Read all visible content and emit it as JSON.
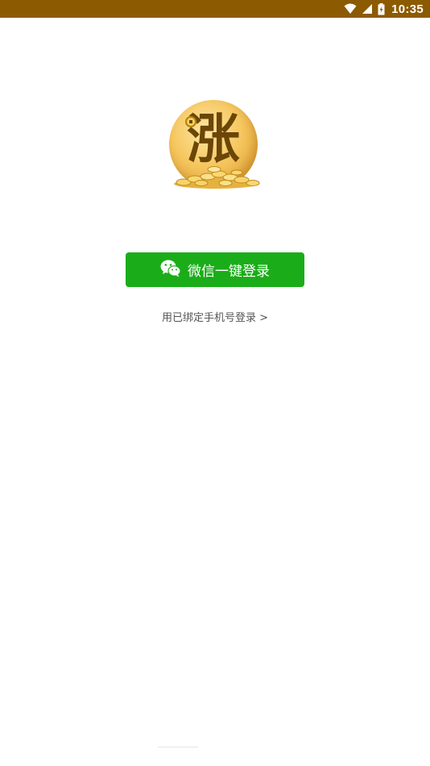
{
  "status_bar": {
    "time": "10:35",
    "background_color": "#8c5a00",
    "icons": [
      "wifi-icon",
      "cell-signal-icon",
      "battery-icon"
    ]
  },
  "logo": {
    "character": "涨",
    "icon": "gold-coin-logo"
  },
  "login": {
    "wechat_button_label": "微信一键登录",
    "wechat_button_color": "#1aad19",
    "wechat_icon": "wechat-icon",
    "phone_login_label": "用已绑定手机号登录 >"
  }
}
